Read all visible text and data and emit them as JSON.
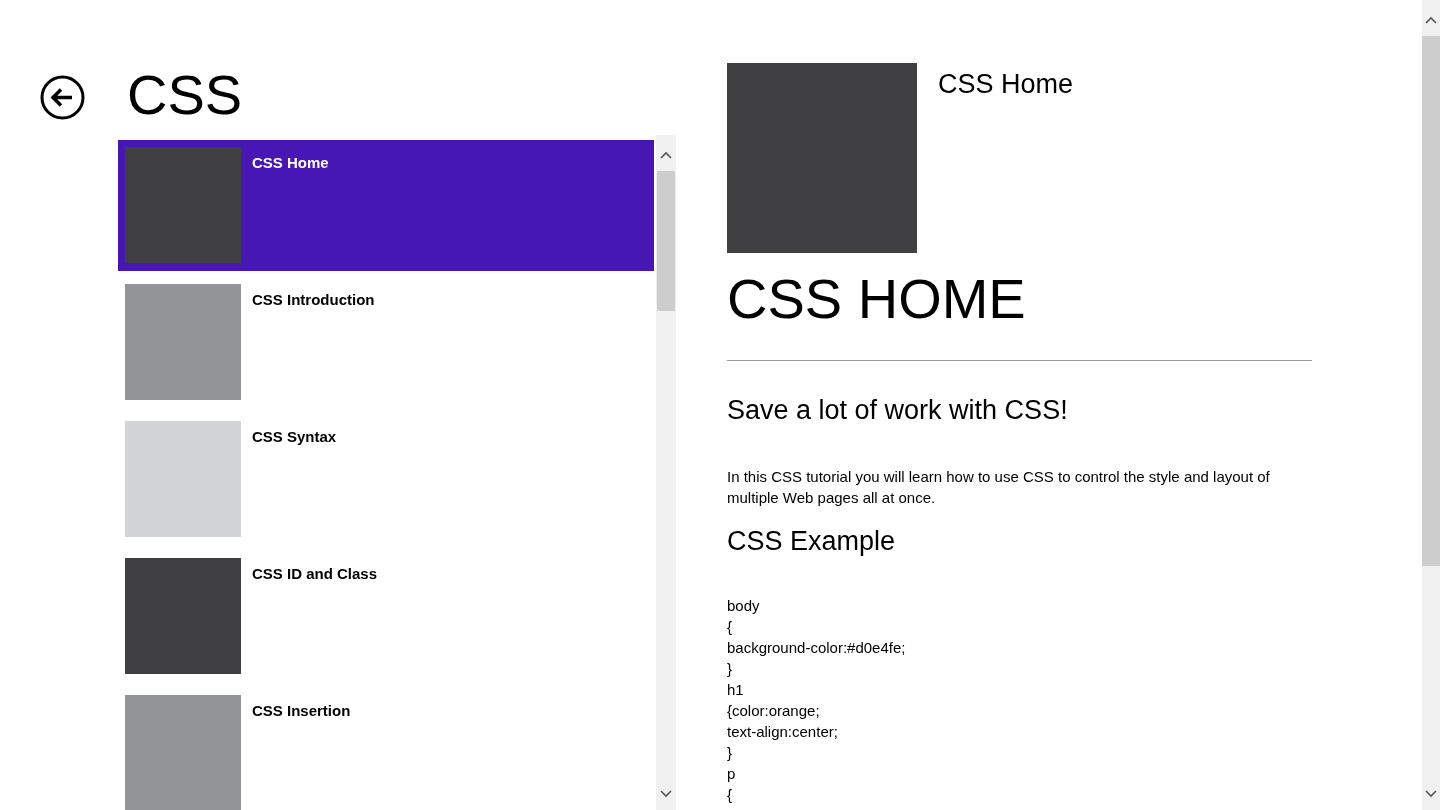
{
  "header": {
    "title": "CSS"
  },
  "list": {
    "items": [
      {
        "label": "CSS Home",
        "selected": true,
        "color": "#404042"
      },
      {
        "label": "CSS Introduction",
        "selected": false,
        "color": "#939498"
      },
      {
        "label": "CSS Syntax",
        "selected": false,
        "color": "#d2d3d5"
      },
      {
        "label": "CSS ID and Class",
        "selected": false,
        "color": "#404042"
      },
      {
        "label": "CSS Insertion",
        "selected": false,
        "color": "#939498"
      }
    ]
  },
  "detail": {
    "title": "CSS Home",
    "heading": "CSS HOME",
    "subheading": "Save a lot of work with CSS!",
    "paragraph": "In this CSS tutorial you will learn how to use CSS to control the style and layout of multiple Web pages all at once.",
    "example_heading": "CSS Example",
    "code_lines": [
      "body",
      "{",
      "background-color:#d0e4fe;",
      "}",
      "h1",
      "{color:orange;",
      "text-align:center;",
      "}",
      "p",
      "{"
    ]
  }
}
